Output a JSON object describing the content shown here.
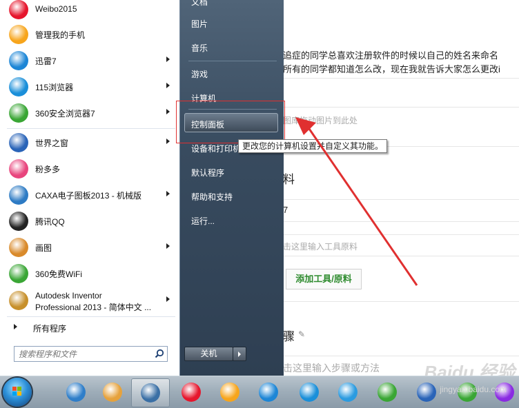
{
  "background_page": {
    "description_line1": "追症的同学总喜欢注册软件的时候以自己的姓名来命名",
    "description_line2": "所有的同学都知道怎么改，现在我就告诉大家怎么更改i",
    "upload_hint": "图库拖动图片到此处",
    "materials_heading": "料",
    "seven": "7",
    "tool_input_hint": "击这里输入工具原料",
    "add_tool_button": "添加工具/原料",
    "steps_heading": "骤",
    "step_input_hint": "击这里输入步骤或方法",
    "watermark": "Baidu 经验",
    "watermark_url": "jingyan.baidu.com"
  },
  "start_menu": {
    "programs": [
      {
        "label": "Weibo2015",
        "icon": "weibo-icon",
        "color": "#e6162d",
        "submenu": false
      },
      {
        "label": "管理我的手机",
        "icon": "phone-manager-icon",
        "color": "#f7a51c",
        "submenu": false
      },
      {
        "label": "迅雷7",
        "icon": "xunlei-icon",
        "color": "#1d86d6",
        "submenu": true
      },
      {
        "label": "115浏览器",
        "icon": "browser115-icon",
        "color": "#1a8fd9",
        "submenu": true
      },
      {
        "label": "360安全浏览器7",
        "icon": "browser360-icon",
        "color": "#3aa635",
        "submenu": true
      },
      {
        "label": "世界之窗",
        "icon": "theworld-icon",
        "color": "#2a64b8",
        "submenu": true
      },
      {
        "label": "粉多多",
        "icon": "fenduoduo-icon",
        "color": "#e8457d",
        "submenu": false
      },
      {
        "label": "CAXA电子图板2013 - 机械版",
        "icon": "caxa-icon",
        "color": "#2d7bc4",
        "submenu": true
      },
      {
        "label": "腾讯QQ",
        "icon": "qq-icon",
        "color": "#222222",
        "submenu": false
      },
      {
        "label": "画图",
        "icon": "paint-icon",
        "color": "#d98a2b",
        "submenu": true
      },
      {
        "label": "360免费WiFi",
        "icon": "wifi360-icon",
        "color": "#3aa635",
        "submenu": false
      },
      {
        "label_line1": "Autodesk Inventor",
        "label_line2": "Professional 2013 - 简体中文 ...",
        "icon": "inventor-icon",
        "color": "#c7902b",
        "submenu": true
      }
    ],
    "all_programs": "所有程序",
    "search_placeholder": "搜索程序和文件",
    "right_items": {
      "documents": "文档",
      "pictures": "图片",
      "music": "音乐",
      "games": "游戏",
      "computer": "计算机",
      "control_panel": "控制面板",
      "devices_printers": "设备和打印机",
      "default_programs": "默认程序",
      "help_support": "帮助和支持",
      "run": "运行..."
    },
    "shutdown": "关机"
  },
  "tooltip": "更改您的计算机设置并自定义其功能。",
  "taskbar": {
    "items": [
      "explorer-icon",
      "pinwheel-icon",
      "media-player-icon",
      "weibo-icon",
      "phone-manager-icon",
      "xunlei-icon",
      "browser115-icon",
      "cloud-icon",
      "browser360-icon",
      "theworld-icon",
      "shield-icon",
      "winrar-icon"
    ]
  },
  "accent": {
    "annotation_red": "#e03030"
  }
}
